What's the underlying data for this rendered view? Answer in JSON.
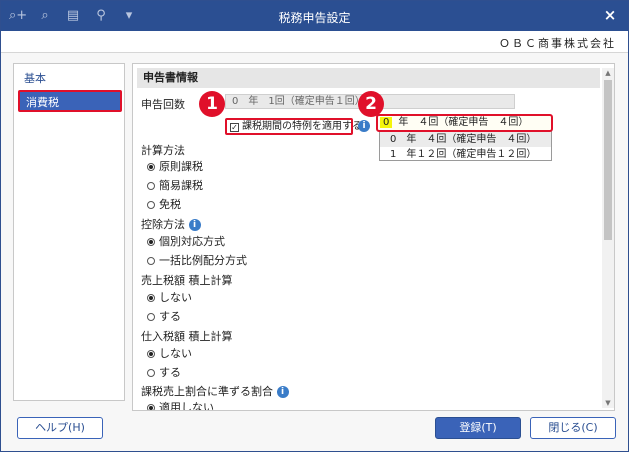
{
  "window": {
    "title": "税務申告設定",
    "close_symbol": "×"
  },
  "toolbar": {
    "icons": [
      "search-plus-icon",
      "search-icon",
      "print-icon",
      "tool-icon",
      "menu-icon"
    ],
    "search_plus": "⌕+",
    "search": "⌕",
    "print": "▤",
    "tool": "⚲",
    "menu": "▾"
  },
  "company": {
    "name": "ＯＢＣ商事株式会社"
  },
  "sidebar": {
    "items": [
      {
        "label": "基本"
      },
      {
        "label": "消費税"
      }
    ]
  },
  "content": {
    "section_title": "申告書情報",
    "filing_count": {
      "label": "申告回数",
      "value_text": "0　年　1回（確定申告１回）"
    },
    "special_period": {
      "label": "課税期間の特例を適用する",
      "checked": true,
      "check_mark": "✓"
    },
    "calc_method": {
      "label": "計算方法",
      "options": [
        "原則課税",
        "簡易課税",
        "免税"
      ],
      "selected": 0
    },
    "deduction_method": {
      "label": "控除方法",
      "options": [
        "個別対応方式",
        "一括比例配分方式"
      ],
      "selected": 0
    },
    "sales_tax_accum": {
      "label": "売上税額 積上計算",
      "options": [
        "しない",
        "する"
      ],
      "selected": 0
    },
    "purchase_tax_accum": {
      "label": "仕入税額 積上計算",
      "options": [
        "しない",
        "する"
      ],
      "selected": 0
    },
    "taxable_ratio": {
      "label": "課税売上割合に準ずる割合",
      "options": [
        "適用しない"
      ],
      "selected": 0
    },
    "info_glyph": "i"
  },
  "dropdown": {
    "selected": {
      "num": "0",
      "text": "年　４回（確定申告　４回）"
    },
    "items": [
      "0　年　４回（確定申告　４回）",
      "1　年１２回（確定申告１２回）"
    ]
  },
  "markers": [
    "1",
    "2"
  ],
  "buttons": {
    "help": "ヘルプ(H)",
    "register": "登録(T)",
    "close": "閉じる(C)"
  },
  "scroll": {
    "up": "▲",
    "down": "▼"
  }
}
